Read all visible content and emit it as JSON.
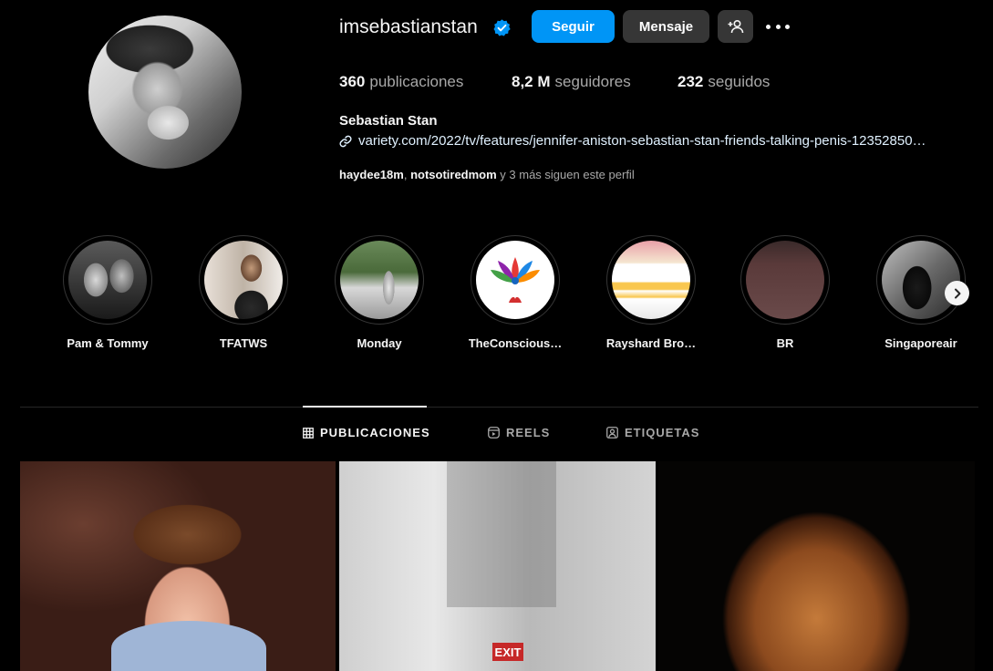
{
  "profile": {
    "username": "imsebastianstan",
    "follow_label": "Seguir",
    "message_label": "Mensaje",
    "stats": {
      "posts_count": "360",
      "posts_label": "publicaciones",
      "followers_count": "8,2 M",
      "followers_label": "seguidores",
      "following_count": "232",
      "following_label": "seguidos"
    },
    "full_name": "Sebastian Stan",
    "link": "variety.com/2022/tv/features/jennifer-aniston-sebastian-stan-friends-talking-penis-12352850…",
    "followed_by": {
      "user1": "haydee18m",
      "sep": ", ",
      "user2": "notsotiredmom",
      "rest": " y 3 más siguen este perfil"
    }
  },
  "highlights": [
    {
      "label": "Pam & Tommy"
    },
    {
      "label": "TFATWS"
    },
    {
      "label": "Monday"
    },
    {
      "label": "TheConscious…"
    },
    {
      "label": "Rayshard Bro…"
    },
    {
      "label": "BR"
    },
    {
      "label": "Singaporeair"
    }
  ],
  "tabs": [
    {
      "label": "PUBLICACIONES"
    },
    {
      "label": "REELS"
    },
    {
      "label": "ETIQUETAS"
    }
  ],
  "posts": {
    "exit_sign": "EXIT"
  },
  "colors": {
    "background": "#000000",
    "follow_button": "#0095f6",
    "secondary_button": "#363636",
    "verified_badge": "#0095f6",
    "muted_text": "#a8a8a8"
  }
}
